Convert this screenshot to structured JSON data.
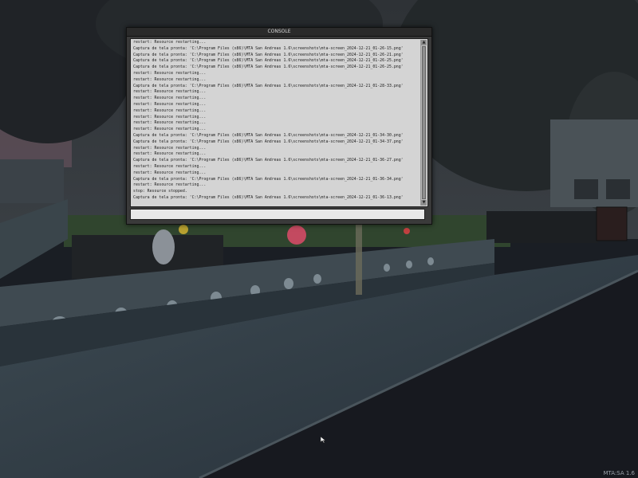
{
  "console": {
    "title": "CONSOLE",
    "lines": [
      "restart: Resource restarting...",
      "Captura de tela pronta: 'C:\\Program Files (x86)\\MTA San Andreas 1.6\\screenshots\\mta-screen_2024-12-21_01-26-15.png'",
      "Captura de tela pronta: 'C:\\Program Files (x86)\\MTA San Andreas 1.6\\screenshots\\mta-screen_2024-12-21_01-26-21.png'",
      "Captura de tela pronta: 'C:\\Program Files (x86)\\MTA San Andreas 1.6\\screenshots\\mta-screen_2024-12-21_01-26-25.png'",
      "Captura de tela pronta: 'C:\\Program Files (x86)\\MTA San Andreas 1.6\\screenshots\\mta-screen_2024-12-21_01-26-25.png'",
      "restart: Resource restarting...",
      "restart: Resource restarting...",
      "Captura de tela pronta: 'C:\\Program Files (x86)\\MTA San Andreas 1.6\\screenshots\\mta-screen_2024-12-21_01-28-33.png'",
      "restart: Resource restarting...",
      "restart: Resource restarting...",
      "restart: Resource restarting...",
      "restart: Resource restarting...",
      "restart: Resource restarting...",
      "restart: Resource restarting...",
      "restart: Resource restarting...",
      "Captura de tela pronta: 'C:\\Program Files (x86)\\MTA San Andreas 1.6\\screenshots\\mta-screen_2024-12-21_01-34-30.png'",
      "Captura de tela pronta: 'C:\\Program Files (x86)\\MTA San Andreas 1.6\\screenshots\\mta-screen_2024-12-21_01-34-37.png'",
      "restart: Resource restarting...",
      "restart: Resource restarting...",
      "Captura de tela pronta: 'C:\\Program Files (x86)\\MTA San Andreas 1.6\\screenshots\\mta-screen_2024-12-21_01-36-27.png'",
      "restart: Resource restarting...",
      "restart: Resource restarting...",
      "Captura de tela pronta: 'C:\\Program Files (x86)\\MTA San Andreas 1.6\\screenshots\\mta-screen_2024-12-21_01-36-34.png'",
      "restart: Resource restarting...",
      "stop: Resource stopped.",
      "Captura de tela pronta: 'C:\\Program Files (x86)\\MTA San Andreas 1.6\\screenshots\\mta-screen_2024-12-21_01-36-13.png'"
    ],
    "input_value": "",
    "scroll_up_icon": "arrow-up-icon",
    "scroll_down_icon": "arrow-down-icon"
  },
  "hud": {
    "version": "MTA:SA 1.6"
  },
  "colors": {
    "console_bg": "#d4d4d4",
    "console_frame": "#3a3a3a",
    "sky": "#2c2f33",
    "street": "#17191f"
  }
}
